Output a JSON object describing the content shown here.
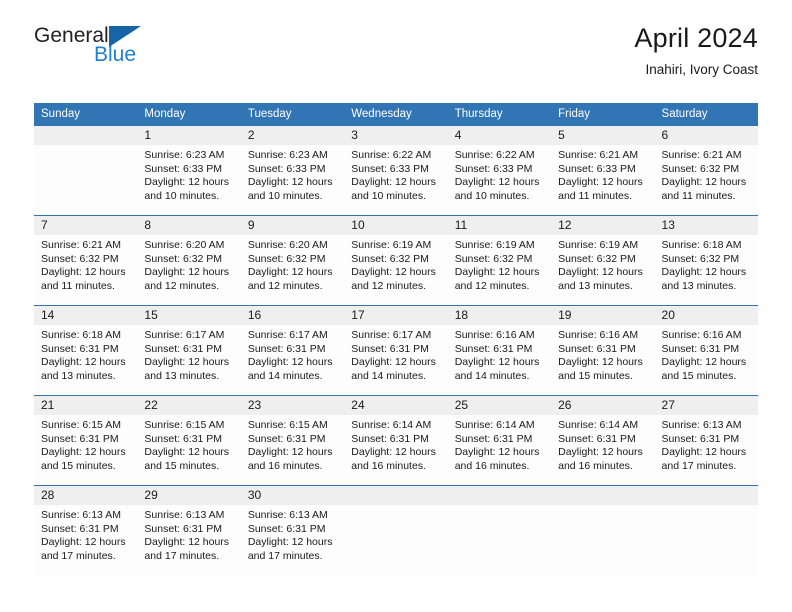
{
  "brand": {
    "name_top": "General",
    "name_bottom": "Blue",
    "triangle_color": "#1565a8",
    "blue_text_color": "#1f7fd4"
  },
  "header": {
    "title": "April 2024",
    "subtitle": "Inahiri, Ivory Coast"
  },
  "theme": {
    "header_blue": "#3275b4",
    "row_rule_blue": "#2f73b3",
    "daynum_band": "#efefef",
    "page_background": "#ffffff"
  },
  "weekday_headers": [
    "Sunday",
    "Monday",
    "Tuesday",
    "Wednesday",
    "Thursday",
    "Friday",
    "Saturday"
  ],
  "labels": {
    "sunrise_prefix": "Sunrise:",
    "sunset_prefix": "Sunset:",
    "daylight_prefix": "Daylight:"
  },
  "weeks": [
    [
      {
        "day": "",
        "sunrise": "",
        "sunset": "",
        "daylight_l1": "",
        "daylight_l2": ""
      },
      {
        "day": "1",
        "sunrise": "Sunrise: 6:23 AM",
        "sunset": "Sunset: 6:33 PM",
        "daylight_l1": "Daylight: 12 hours",
        "daylight_l2": "and 10 minutes."
      },
      {
        "day": "2",
        "sunrise": "Sunrise: 6:23 AM",
        "sunset": "Sunset: 6:33 PM",
        "daylight_l1": "Daylight: 12 hours",
        "daylight_l2": "and 10 minutes."
      },
      {
        "day": "3",
        "sunrise": "Sunrise: 6:22 AM",
        "sunset": "Sunset: 6:33 PM",
        "daylight_l1": "Daylight: 12 hours",
        "daylight_l2": "and 10 minutes."
      },
      {
        "day": "4",
        "sunrise": "Sunrise: 6:22 AM",
        "sunset": "Sunset: 6:33 PM",
        "daylight_l1": "Daylight: 12 hours",
        "daylight_l2": "and 10 minutes."
      },
      {
        "day": "5",
        "sunrise": "Sunrise: 6:21 AM",
        "sunset": "Sunset: 6:33 PM",
        "daylight_l1": "Daylight: 12 hours",
        "daylight_l2": "and 11 minutes."
      },
      {
        "day": "6",
        "sunrise": "Sunrise: 6:21 AM",
        "sunset": "Sunset: 6:32 PM",
        "daylight_l1": "Daylight: 12 hours",
        "daylight_l2": "and 11 minutes."
      }
    ],
    [
      {
        "day": "7",
        "sunrise": "Sunrise: 6:21 AM",
        "sunset": "Sunset: 6:32 PM",
        "daylight_l1": "Daylight: 12 hours",
        "daylight_l2": "and 11 minutes."
      },
      {
        "day": "8",
        "sunrise": "Sunrise: 6:20 AM",
        "sunset": "Sunset: 6:32 PM",
        "daylight_l1": "Daylight: 12 hours",
        "daylight_l2": "and 12 minutes."
      },
      {
        "day": "9",
        "sunrise": "Sunrise: 6:20 AM",
        "sunset": "Sunset: 6:32 PM",
        "daylight_l1": "Daylight: 12 hours",
        "daylight_l2": "and 12 minutes."
      },
      {
        "day": "10",
        "sunrise": "Sunrise: 6:19 AM",
        "sunset": "Sunset: 6:32 PM",
        "daylight_l1": "Daylight: 12 hours",
        "daylight_l2": "and 12 minutes."
      },
      {
        "day": "11",
        "sunrise": "Sunrise: 6:19 AM",
        "sunset": "Sunset: 6:32 PM",
        "daylight_l1": "Daylight: 12 hours",
        "daylight_l2": "and 12 minutes."
      },
      {
        "day": "12",
        "sunrise": "Sunrise: 6:19 AM",
        "sunset": "Sunset: 6:32 PM",
        "daylight_l1": "Daylight: 12 hours",
        "daylight_l2": "and 13 minutes."
      },
      {
        "day": "13",
        "sunrise": "Sunrise: 6:18 AM",
        "sunset": "Sunset: 6:32 PM",
        "daylight_l1": "Daylight: 12 hours",
        "daylight_l2": "and 13 minutes."
      }
    ],
    [
      {
        "day": "14",
        "sunrise": "Sunrise: 6:18 AM",
        "sunset": "Sunset: 6:31 PM",
        "daylight_l1": "Daylight: 12 hours",
        "daylight_l2": "and 13 minutes."
      },
      {
        "day": "15",
        "sunrise": "Sunrise: 6:17 AM",
        "sunset": "Sunset: 6:31 PM",
        "daylight_l1": "Daylight: 12 hours",
        "daylight_l2": "and 13 minutes."
      },
      {
        "day": "16",
        "sunrise": "Sunrise: 6:17 AM",
        "sunset": "Sunset: 6:31 PM",
        "daylight_l1": "Daylight: 12 hours",
        "daylight_l2": "and 14 minutes."
      },
      {
        "day": "17",
        "sunrise": "Sunrise: 6:17 AM",
        "sunset": "Sunset: 6:31 PM",
        "daylight_l1": "Daylight: 12 hours",
        "daylight_l2": "and 14 minutes."
      },
      {
        "day": "18",
        "sunrise": "Sunrise: 6:16 AM",
        "sunset": "Sunset: 6:31 PM",
        "daylight_l1": "Daylight: 12 hours",
        "daylight_l2": "and 14 minutes."
      },
      {
        "day": "19",
        "sunrise": "Sunrise: 6:16 AM",
        "sunset": "Sunset: 6:31 PM",
        "daylight_l1": "Daylight: 12 hours",
        "daylight_l2": "and 15 minutes."
      },
      {
        "day": "20",
        "sunrise": "Sunrise: 6:16 AM",
        "sunset": "Sunset: 6:31 PM",
        "daylight_l1": "Daylight: 12 hours",
        "daylight_l2": "and 15 minutes."
      }
    ],
    [
      {
        "day": "21",
        "sunrise": "Sunrise: 6:15 AM",
        "sunset": "Sunset: 6:31 PM",
        "daylight_l1": "Daylight: 12 hours",
        "daylight_l2": "and 15 minutes."
      },
      {
        "day": "22",
        "sunrise": "Sunrise: 6:15 AM",
        "sunset": "Sunset: 6:31 PM",
        "daylight_l1": "Daylight: 12 hours",
        "daylight_l2": "and 15 minutes."
      },
      {
        "day": "23",
        "sunrise": "Sunrise: 6:15 AM",
        "sunset": "Sunset: 6:31 PM",
        "daylight_l1": "Daylight: 12 hours",
        "daylight_l2": "and 16 minutes."
      },
      {
        "day": "24",
        "sunrise": "Sunrise: 6:14 AM",
        "sunset": "Sunset: 6:31 PM",
        "daylight_l1": "Daylight: 12 hours",
        "daylight_l2": "and 16 minutes."
      },
      {
        "day": "25",
        "sunrise": "Sunrise: 6:14 AM",
        "sunset": "Sunset: 6:31 PM",
        "daylight_l1": "Daylight: 12 hours",
        "daylight_l2": "and 16 minutes."
      },
      {
        "day": "26",
        "sunrise": "Sunrise: 6:14 AM",
        "sunset": "Sunset: 6:31 PM",
        "daylight_l1": "Daylight: 12 hours",
        "daylight_l2": "and 16 minutes."
      },
      {
        "day": "27",
        "sunrise": "Sunrise: 6:13 AM",
        "sunset": "Sunset: 6:31 PM",
        "daylight_l1": "Daylight: 12 hours",
        "daylight_l2": "and 17 minutes."
      }
    ],
    [
      {
        "day": "28",
        "sunrise": "Sunrise: 6:13 AM",
        "sunset": "Sunset: 6:31 PM",
        "daylight_l1": "Daylight: 12 hours",
        "daylight_l2": "and 17 minutes."
      },
      {
        "day": "29",
        "sunrise": "Sunrise: 6:13 AM",
        "sunset": "Sunset: 6:31 PM",
        "daylight_l1": "Daylight: 12 hours",
        "daylight_l2": "and 17 minutes."
      },
      {
        "day": "30",
        "sunrise": "Sunrise: 6:13 AM",
        "sunset": "Sunset: 6:31 PM",
        "daylight_l1": "Daylight: 12 hours",
        "daylight_l2": "and 17 minutes."
      },
      {
        "day": "",
        "sunrise": "",
        "sunset": "",
        "daylight_l1": "",
        "daylight_l2": ""
      },
      {
        "day": "",
        "sunrise": "",
        "sunset": "",
        "daylight_l1": "",
        "daylight_l2": ""
      },
      {
        "day": "",
        "sunrise": "",
        "sunset": "",
        "daylight_l1": "",
        "daylight_l2": ""
      },
      {
        "day": "",
        "sunrise": "",
        "sunset": "",
        "daylight_l1": "",
        "daylight_l2": ""
      }
    ]
  ]
}
